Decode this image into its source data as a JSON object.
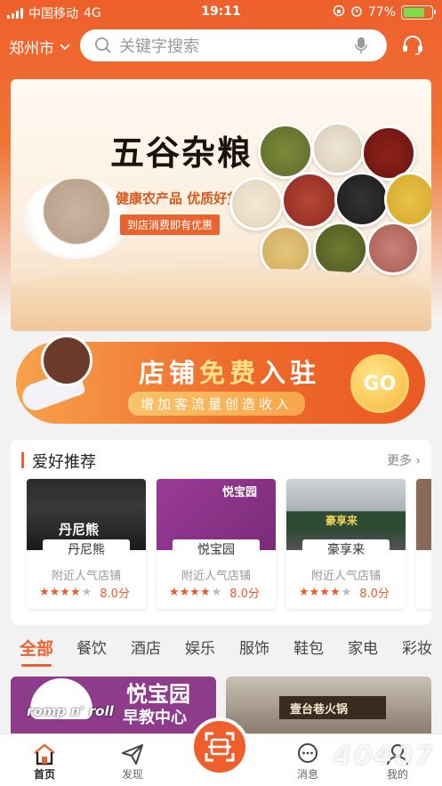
{
  "status_bar": {
    "carrier": "中国移动",
    "network": "4G",
    "time": "19:11",
    "battery": "77%",
    "battery_level": 0.77
  },
  "header": {
    "city": "郑州市",
    "search_placeholder": "关键字搜索"
  },
  "banner": {
    "title": "五谷杂粮",
    "subtitle": "健康农产品  优质好货",
    "tag": "到店消费即有优惠"
  },
  "promo": {
    "title_a": "店铺",
    "title_b": "免费",
    "title_c": "入驻",
    "subtitle": "增加客流量创造收入",
    "go": "GO"
  },
  "recommend": {
    "title": "爱好推荐",
    "more": "更多",
    "items": [
      {
        "name": "丹尼熊",
        "desc": "附近人气店铺",
        "score": "8.0分",
        "stars": 4,
        "sign": "丹尼熊"
      },
      {
        "name": "悦宝园",
        "desc": "附近人气店铺",
        "score": "8.0分",
        "stars": 4,
        "sign": "悦宝园"
      },
      {
        "name": "豪享来",
        "desc": "附近人气店铺",
        "score": "8.0分",
        "stars": 4,
        "sign": "豪享来"
      }
    ]
  },
  "categories": [
    "全部",
    "餐饮",
    "酒店",
    "娱乐",
    "服饰",
    "鞋包",
    "家电",
    "彩妆"
  ],
  "feed": [
    {
      "sign_title": "悦宝园",
      "sign_sub": "早教中心",
      "brand": "romp n' roll"
    },
    {
      "sign_title": "壹台巷火锅"
    }
  ],
  "tabbar": {
    "home": "首页",
    "discover": "发现",
    "message": "消息",
    "mine": "我的"
  },
  "watermark": "40407",
  "colors": {
    "accent": "#ee5f2b",
    "star": "#ee5a2b"
  }
}
